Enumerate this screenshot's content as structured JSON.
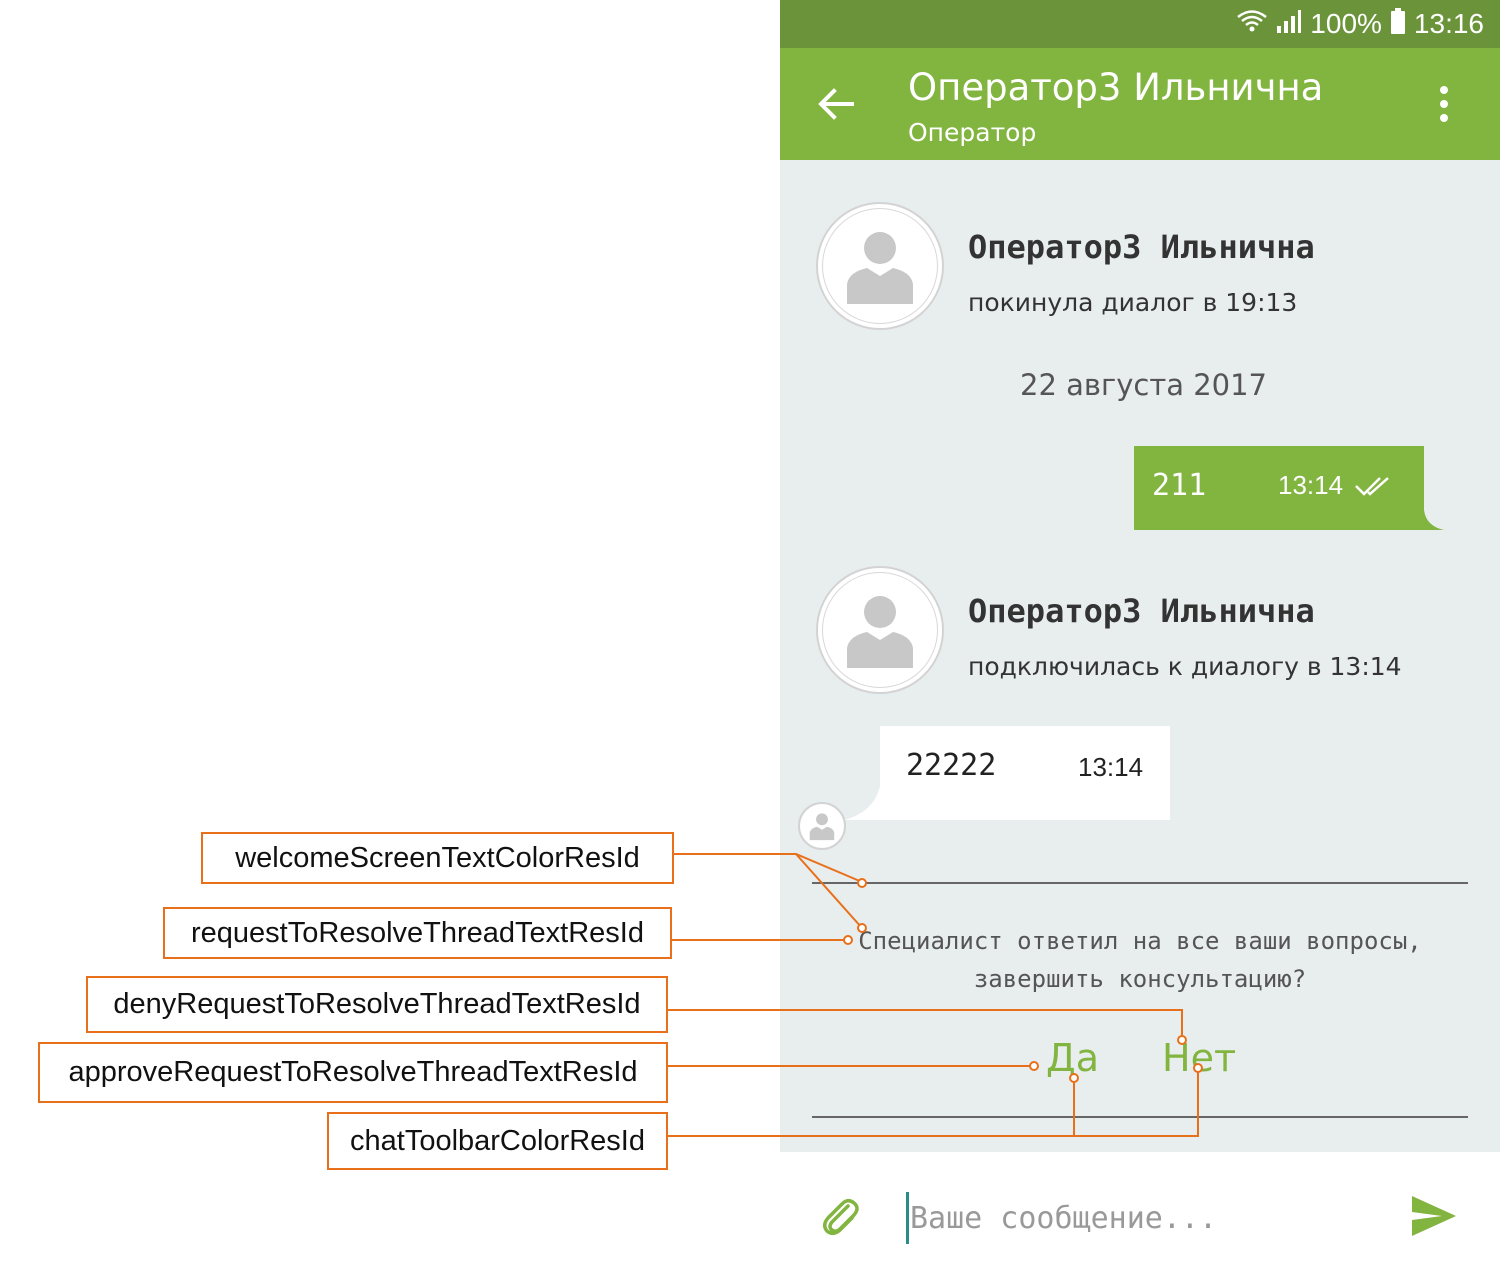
{
  "status_bar": {
    "battery": "100%",
    "time": "13:16",
    "icons": [
      "wifi-icon",
      "signal-icon",
      "battery-icon"
    ]
  },
  "toolbar": {
    "title": "Оператор3 Ильнична",
    "subtitle": "Оператор",
    "color": "#82b440",
    "back_icon": "arrow-back-icon",
    "menu_icon": "more-vert-icon"
  },
  "chat": {
    "events": [
      {
        "name": "Оператор3 Ильнична",
        "info": "покинула диалог в 19:13"
      },
      {
        "name": "Оператор3 Ильнична",
        "info": "подключилась к диалогу в 13:14"
      }
    ],
    "date_separator": "22 августа 2017",
    "outgoing": {
      "text": "211",
      "time": "13:14",
      "status_icon": "double-check-icon"
    },
    "incoming": {
      "text": "22222",
      "time": "13:14"
    },
    "resolve": {
      "question_line1": "Специалист ответил на все ваши вопросы,",
      "question_line2": "завершить консультацию?",
      "approve_label": "Да",
      "deny_label": "Нет"
    }
  },
  "input": {
    "placeholder": "Ваше сообщение...",
    "value": "",
    "attach_icon": "paperclip-icon",
    "send_icon": "send-icon"
  },
  "annotations": [
    {
      "label": "welcomeScreenTextColorResId"
    },
    {
      "label": "requestToResolveThreadTextResId"
    },
    {
      "label": "denyRequestToResolveThreadTextResId"
    },
    {
      "label": "approveRequestToResolveThreadTextResId"
    },
    {
      "label": "chatToolbarColorResId"
    }
  ],
  "colors": {
    "accent_green": "#82b440",
    "status_bar": "#6b943a",
    "annotation_orange": "#e8701a",
    "chat_background": "#e8eded"
  }
}
